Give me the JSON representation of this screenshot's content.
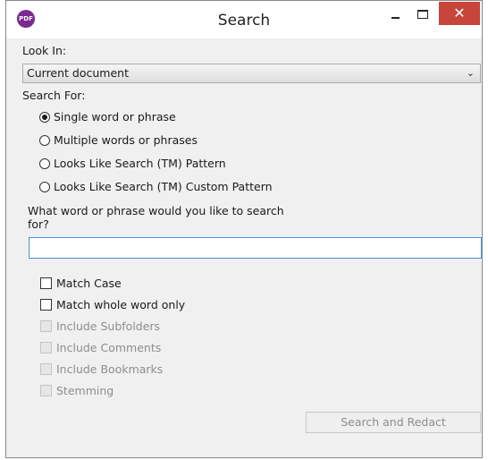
{
  "window": {
    "title": "Search",
    "app_icon_text": "PDF",
    "close_glyph": "✕"
  },
  "look_in": {
    "label": "Look In:",
    "selected": "Current document"
  },
  "search_for": {
    "label": "Search For:",
    "options": [
      {
        "label": "Single word or phrase",
        "selected": true
      },
      {
        "label": "Multiple words or phrases",
        "selected": false
      },
      {
        "label": "Looks Like Search (TM) Pattern",
        "selected": false
      },
      {
        "label": "Looks Like Search (TM) Custom Pattern",
        "selected": false
      }
    ]
  },
  "query": {
    "prompt_line1": "What word or phrase would you like to search",
    "prompt_line2": "for?",
    "value": "",
    "placeholder": ""
  },
  "options": [
    {
      "label": "Match Case",
      "checked": false,
      "enabled": true
    },
    {
      "label": "Match whole word only",
      "checked": false,
      "enabled": true
    },
    {
      "label": "Include Subfolders",
      "checked": false,
      "enabled": false
    },
    {
      "label": "Include Comments",
      "checked": false,
      "enabled": false
    },
    {
      "label": "Include Bookmarks",
      "checked": false,
      "enabled": false
    },
    {
      "label": "Stemming",
      "checked": false,
      "enabled": false
    }
  ],
  "action": {
    "label": "Search and Redact"
  }
}
